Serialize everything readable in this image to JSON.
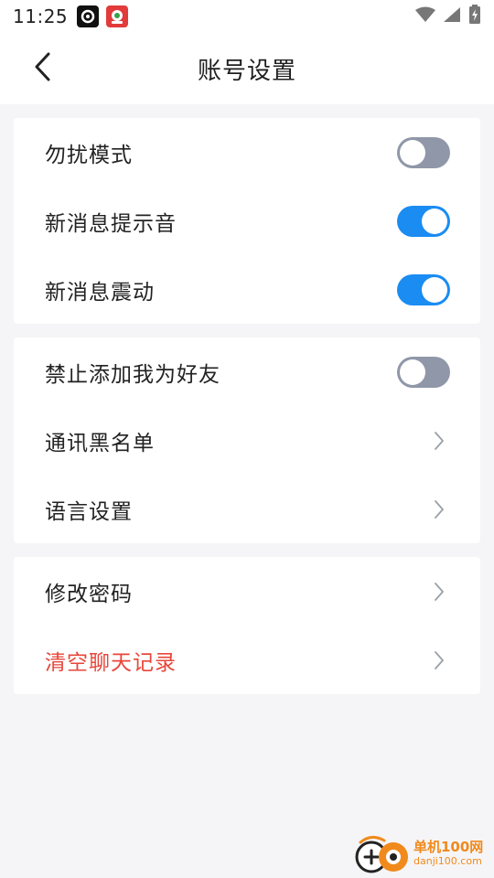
{
  "status_bar": {
    "time": "11:25",
    "icons": [
      "app-notification-icon",
      "app-notification-icon-2",
      "wifi-icon",
      "signal-icon",
      "battery-charging-icon"
    ]
  },
  "header": {
    "title": "账号设置",
    "back_icon": "chevron-left-icon"
  },
  "groups": [
    {
      "items": [
        {
          "label": "勿扰模式",
          "control": "toggle",
          "on": false
        },
        {
          "label": "新消息提示音",
          "control": "toggle",
          "on": true
        },
        {
          "label": "新消息震动",
          "control": "toggle",
          "on": true
        }
      ]
    },
    {
      "items": [
        {
          "label": "禁止添加我为好友",
          "control": "toggle",
          "on": false
        },
        {
          "label": "通讯黑名单",
          "control": "chevron"
        },
        {
          "label": "语言设置",
          "control": "chevron"
        }
      ]
    },
    {
      "items": [
        {
          "label": "修改密码",
          "control": "chevron"
        },
        {
          "label": "清空聊天记录",
          "control": "chevron",
          "danger": true
        }
      ]
    }
  ],
  "colors": {
    "toggle_on": "#1a8cf2",
    "toggle_off": "#8f97a8",
    "danger_text": "#e8463a",
    "background": "#f5f5f7"
  },
  "watermark": {
    "line1": "单机100网",
    "line2": "danji100.com"
  }
}
